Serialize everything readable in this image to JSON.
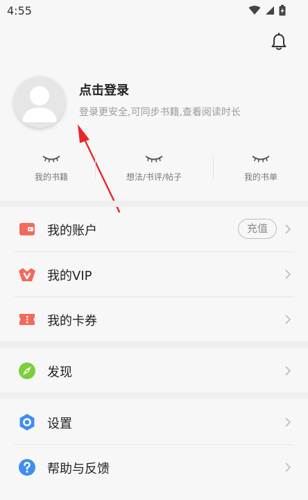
{
  "status_bar": {
    "time": "4:55",
    "icons": [
      "wifi-icon",
      "signal-icon",
      "battery-charging-icon"
    ]
  },
  "header": {
    "bell_icon": "bell-icon"
  },
  "profile": {
    "avatar_icon": "avatar-placeholder-icon",
    "login_title": "点击登录",
    "login_subtitle": "登录更安全,可同步书籍,查看阅读时长"
  },
  "stats": [
    {
      "label": "我的书籍"
    },
    {
      "label": "想法/书评/帖子"
    },
    {
      "label": "我的书单"
    }
  ],
  "menu": {
    "account": {
      "label": "我的账户",
      "recharge_label": "充值",
      "icon": "wallet-icon",
      "color": "#f26a5b"
    },
    "vip": {
      "label": "我的VIP",
      "icon": "vip-crown-icon",
      "color": "#f26a5b"
    },
    "coupons": {
      "label": "我的卡券",
      "icon": "ticket-icon",
      "color": "#f26a5b"
    },
    "discover": {
      "label": "发现",
      "icon": "compass-icon",
      "color": "#7ccf3a"
    },
    "settings": {
      "label": "设置",
      "icon": "settings-hexagon-icon",
      "color": "#3d8ef0"
    },
    "help": {
      "label": "帮助与反馈",
      "icon": "help-icon",
      "color": "#3d8ef0"
    }
  },
  "colors": {
    "accent_red": "#f26a5b",
    "arrow_red": "#e8262a",
    "section_gap": "#efefef"
  }
}
